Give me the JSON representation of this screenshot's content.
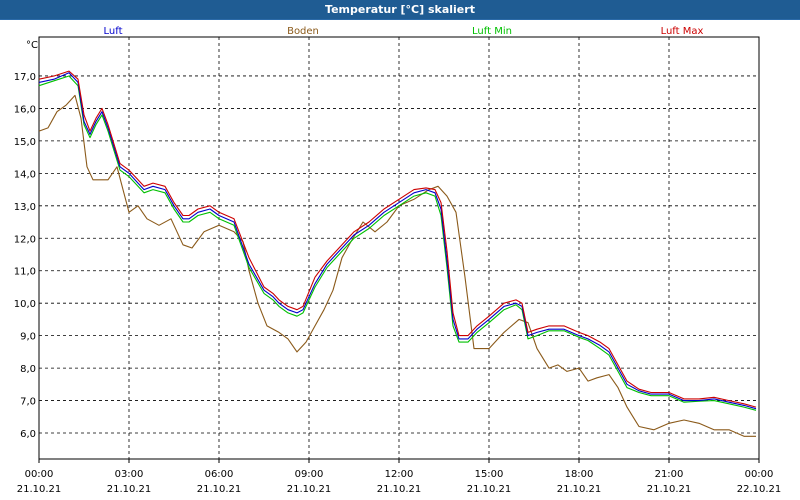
{
  "window": {
    "title": "Temperatur [°C] skaliert"
  },
  "chart_data": {
    "type": "line",
    "unit_label": "°C",
    "ylim": [
      5.2,
      18.2
    ],
    "y_ticks": [
      6.0,
      7.0,
      8.0,
      9.0,
      10.0,
      11.0,
      12.0,
      13.0,
      14.0,
      15.0,
      16.0,
      17.0
    ],
    "y_tick_labels": [
      "6,0",
      "7,0",
      "8,0",
      "9,0",
      "10,0",
      "11,0",
      "12,0",
      "13,0",
      "14,0",
      "15,0",
      "16,0",
      "17,0"
    ],
    "xlim": [
      0,
      24
    ],
    "x_ticks": [
      0,
      3,
      6,
      9,
      12,
      15,
      18,
      21,
      24
    ],
    "x_tick_times": [
      "00:00",
      "03:00",
      "06:00",
      "09:00",
      "12:00",
      "15:00",
      "18:00",
      "21:00",
      "00:00"
    ],
    "x_tick_dates": [
      "21.10.21",
      "21.10.21",
      "21.10.21",
      "21.10.21",
      "21.10.21",
      "21.10.21",
      "21.10.21",
      "21.10.21",
      "22.10.21"
    ],
    "grid": true,
    "legend_position": "top",
    "series": [
      {
        "name": "Luft",
        "color": "#0000cc",
        "x": [
          0,
          0.5,
          1.0,
          1.3,
          1.5,
          1.7,
          1.9,
          2.1,
          2.3,
          2.5,
          2.7,
          3.0,
          3.3,
          3.5,
          3.8,
          4.2,
          4.5,
          4.8,
          5.0,
          5.3,
          5.7,
          6.0,
          6.5,
          7.0,
          7.5,
          7.8,
          8.0,
          8.3,
          8.6,
          8.8,
          9.2,
          9.6,
          10.0,
          10.5,
          11.0,
          11.5,
          12.0,
          12.5,
          12.9,
          13.2,
          13.4,
          13.6,
          13.8,
          14.0,
          14.3,
          14.6,
          15.0,
          15.5,
          15.9,
          16.1,
          16.3,
          16.6,
          17.0,
          17.5,
          18.0,
          18.3,
          18.7,
          19.0,
          19.3,
          19.6,
          20.0,
          20.4,
          21.0,
          21.5,
          22.0,
          22.5,
          23.0,
          23.5,
          23.9
        ],
        "y": [
          16.8,
          16.9,
          17.1,
          16.8,
          15.6,
          15.2,
          15.6,
          15.9,
          15.4,
          14.8,
          14.2,
          14.0,
          13.7,
          13.5,
          13.6,
          13.5,
          13.0,
          12.6,
          12.6,
          12.8,
          12.9,
          12.7,
          12.5,
          11.2,
          10.4,
          10.2,
          10.0,
          9.8,
          9.7,
          9.8,
          10.6,
          11.2,
          11.6,
          12.1,
          12.4,
          12.8,
          13.1,
          13.4,
          13.5,
          13.4,
          12.9,
          11.3,
          9.5,
          8.9,
          8.9,
          9.2,
          9.5,
          9.9,
          10.0,
          9.9,
          9.0,
          9.1,
          9.2,
          9.2,
          9.0,
          8.9,
          8.7,
          8.5,
          8.0,
          7.5,
          7.3,
          7.2,
          7.2,
          7.0,
          7.0,
          7.05,
          6.95,
          6.85,
          6.75
        ]
      },
      {
        "name": "Boden",
        "color": "#8b5a1a",
        "x": [
          0,
          0.3,
          0.6,
          0.9,
          1.2,
          1.4,
          1.6,
          1.8,
          2.0,
          2.3,
          2.6,
          2.8,
          3.0,
          3.3,
          3.6,
          4.0,
          4.4,
          4.8,
          5.1,
          5.5,
          6.0,
          6.5,
          6.8,
          7.0,
          7.3,
          7.6,
          8.0,
          8.3,
          8.6,
          8.9,
          9.2,
          9.5,
          9.8,
          10.1,
          10.4,
          10.8,
          11.2,
          11.6,
          12.0,
          12.5,
          13.0,
          13.3,
          13.6,
          13.9,
          14.2,
          14.5,
          15.0,
          15.5,
          16.0,
          16.3,
          16.6,
          17.0,
          17.3,
          17.6,
          18.0,
          18.3,
          18.6,
          19.0,
          19.3,
          19.6,
          20.0,
          20.5,
          21.0,
          21.5,
          22.0,
          22.5,
          23.0,
          23.5,
          23.9
        ],
        "y": [
          15.3,
          15.4,
          15.9,
          16.1,
          16.4,
          15.7,
          14.2,
          13.8,
          13.8,
          13.8,
          14.2,
          13.5,
          12.8,
          13.0,
          12.6,
          12.4,
          12.6,
          11.8,
          11.7,
          12.2,
          12.4,
          12.2,
          11.9,
          11.0,
          10.0,
          9.3,
          9.1,
          8.9,
          8.5,
          8.8,
          9.3,
          9.8,
          10.4,
          11.4,
          11.9,
          12.5,
          12.2,
          12.5,
          13.0,
          13.2,
          13.5,
          13.6,
          13.3,
          12.8,
          10.8,
          8.6,
          8.6,
          9.1,
          9.5,
          9.4,
          8.6,
          8.0,
          8.1,
          7.9,
          8.0,
          7.6,
          7.7,
          7.8,
          7.4,
          6.8,
          6.2,
          6.1,
          6.3,
          6.4,
          6.3,
          6.1,
          6.1,
          5.9,
          5.9
        ]
      },
      {
        "name": "Luft Min",
        "color": "#00c000",
        "x": [
          0,
          0.5,
          1.0,
          1.3,
          1.5,
          1.7,
          1.9,
          2.1,
          2.3,
          2.5,
          2.7,
          3.0,
          3.3,
          3.5,
          3.8,
          4.2,
          4.5,
          4.8,
          5.0,
          5.3,
          5.7,
          6.0,
          6.5,
          7.0,
          7.5,
          7.8,
          8.0,
          8.3,
          8.6,
          8.8,
          9.2,
          9.6,
          10.0,
          10.5,
          11.0,
          11.5,
          12.0,
          12.5,
          12.9,
          13.2,
          13.4,
          13.6,
          13.8,
          14.0,
          14.3,
          14.6,
          15.0,
          15.5,
          15.9,
          16.1,
          16.3,
          16.6,
          17.0,
          17.5,
          18.0,
          18.3,
          18.7,
          19.0,
          19.3,
          19.6,
          20.0,
          20.4,
          21.0,
          21.5,
          22.0,
          22.5,
          23.0,
          23.5,
          23.9
        ],
        "y": [
          16.7,
          16.85,
          17.0,
          16.7,
          15.5,
          15.1,
          15.5,
          15.8,
          15.3,
          14.7,
          14.1,
          13.9,
          13.6,
          13.4,
          13.5,
          13.4,
          12.9,
          12.5,
          12.5,
          12.7,
          12.8,
          12.6,
          12.4,
          11.1,
          10.3,
          10.1,
          9.9,
          9.7,
          9.6,
          9.7,
          10.5,
          11.1,
          11.5,
          12.0,
          12.3,
          12.7,
          13.0,
          13.3,
          13.4,
          13.3,
          12.7,
          11.1,
          9.3,
          8.8,
          8.8,
          9.1,
          9.4,
          9.8,
          9.95,
          9.8,
          8.9,
          9.0,
          9.15,
          9.15,
          8.95,
          8.85,
          8.6,
          8.4,
          7.9,
          7.4,
          7.25,
          7.15,
          7.15,
          6.95,
          6.98,
          7.0,
          6.9,
          6.8,
          6.7
        ]
      },
      {
        "name": "Luft Max",
        "color": "#cc0000",
        "x": [
          0,
          0.5,
          1.0,
          1.3,
          1.5,
          1.7,
          1.9,
          2.1,
          2.3,
          2.5,
          2.7,
          3.0,
          3.3,
          3.5,
          3.8,
          4.2,
          4.5,
          4.8,
          5.0,
          5.3,
          5.7,
          6.0,
          6.5,
          7.0,
          7.5,
          7.8,
          8.0,
          8.3,
          8.6,
          8.8,
          9.2,
          9.6,
          10.0,
          10.5,
          11.0,
          11.5,
          12.0,
          12.5,
          12.9,
          13.2,
          13.4,
          13.6,
          13.8,
          14.0,
          14.3,
          14.6,
          15.0,
          15.5,
          15.9,
          16.1,
          16.3,
          16.6,
          17.0,
          17.5,
          18.0,
          18.3,
          18.7,
          19.0,
          19.3,
          19.6,
          20.0,
          20.4,
          21.0,
          21.5,
          22.0,
          22.5,
          23.0,
          23.5,
          23.9
        ],
        "y": [
          16.9,
          17.0,
          17.15,
          16.9,
          15.8,
          15.3,
          15.7,
          16.0,
          15.5,
          14.9,
          14.3,
          14.1,
          13.8,
          13.6,
          13.7,
          13.6,
          13.1,
          12.7,
          12.7,
          12.9,
          13.0,
          12.8,
          12.6,
          11.4,
          10.5,
          10.3,
          10.1,
          9.9,
          9.8,
          9.9,
          10.8,
          11.3,
          11.7,
          12.2,
          12.5,
          12.9,
          13.2,
          13.5,
          13.55,
          13.5,
          13.1,
          11.6,
          9.7,
          9.0,
          9.0,
          9.3,
          9.6,
          10.0,
          10.1,
          10.0,
          9.1,
          9.2,
          9.3,
          9.3,
          9.1,
          9.0,
          8.8,
          8.6,
          8.1,
          7.6,
          7.35,
          7.25,
          7.25,
          7.05,
          7.05,
          7.1,
          7.0,
          6.9,
          6.8
        ]
      }
    ]
  }
}
